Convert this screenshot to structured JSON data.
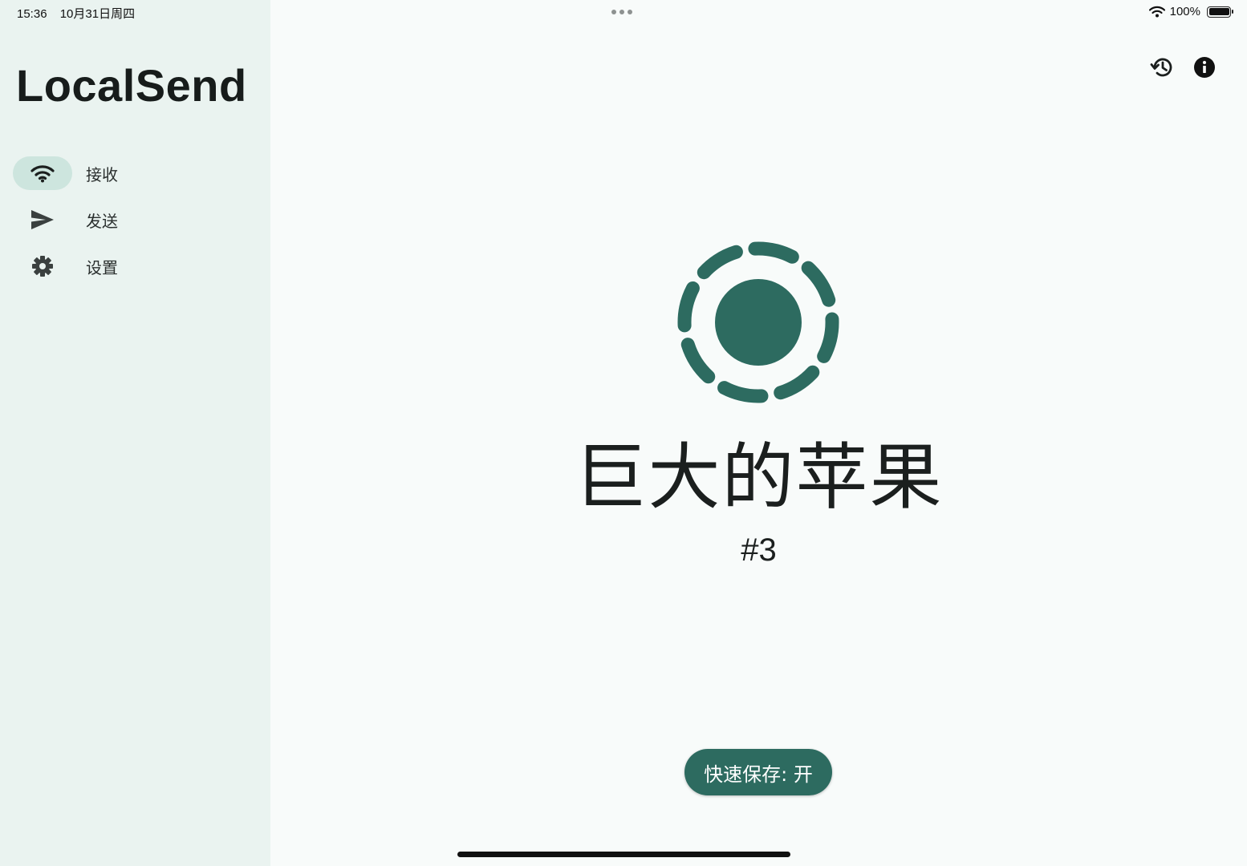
{
  "status_bar": {
    "time": "15:36",
    "date": "10月31日周四",
    "battery": "100%",
    "battery_level": 1.0
  },
  "sidebar": {
    "app_title": "LocalSend",
    "items": [
      {
        "label": "接收",
        "icon": "wifi-icon",
        "active": true
      },
      {
        "label": "发送",
        "icon": "send-icon",
        "active": false
      },
      {
        "label": "设置",
        "icon": "gear-icon",
        "active": false
      }
    ]
  },
  "main": {
    "top_actions": [
      "history-icon",
      "info-icon"
    ],
    "device_name": "巨大的苹果",
    "device_id": "#3",
    "quick_save_label": "快速保存: 开"
  },
  "colors": {
    "accent": "#2d6b60",
    "sidebar_bg": "#eaf3f0",
    "active_pill": "#cde5de",
    "page_bg": "#f8fbfa"
  }
}
